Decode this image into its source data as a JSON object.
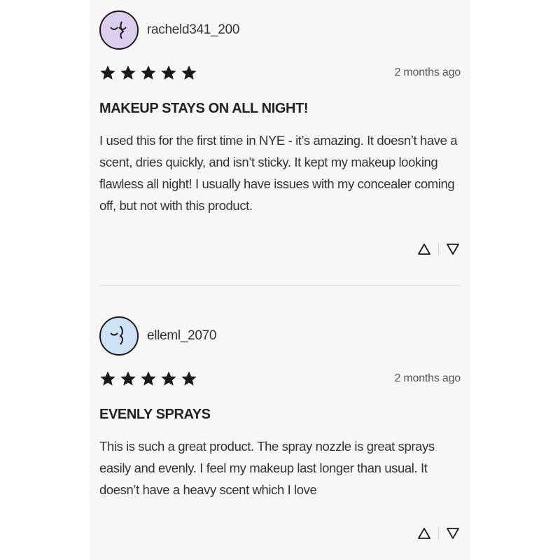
{
  "reviews": [
    {
      "username": "racheld341_200",
      "avatar_icon": "face-profile-icon",
      "avatar_bg": "#dccfee",
      "rating": 5,
      "date": "2 months ago",
      "title": "MAKEUP STAYS ON ALL NIGHT!",
      "body": "I used this for the first time in NYE - it’s amazing. It doesn’t have a scent, dries quickly, and isn’t sticky. It kept my makeup looking flawless all night! I usually have issues with my concealer coming off, but not with this product."
    },
    {
      "username": "elleml_2070",
      "avatar_icon": "face-profile-icon",
      "avatar_bg": "#cfe1f5",
      "rating": 5,
      "date": "2 months ago",
      "title": "EVENLY SPRAYS",
      "body": "This is such a great product. The spray nozzle is great sprays easily and evenly. I feel my makeup last longer than usual. It doesn’t have a heavy scent which I love"
    }
  ],
  "colors": {
    "star": "#1a1a1a",
    "panel_bg": "#f7f7f7",
    "divider": "#dcdcdc"
  },
  "icons": {
    "upvote": "triangle-up-icon",
    "downvote": "triangle-down-icon",
    "star": "star-icon"
  }
}
